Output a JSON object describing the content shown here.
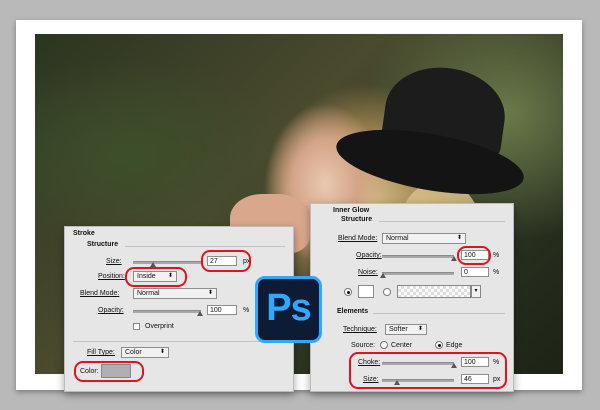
{
  "stroke": {
    "title": "Stroke",
    "structure": "Structure",
    "size_label": "Size:",
    "size_value": "27",
    "size_unit": "px",
    "size_slider": 0.33,
    "position_label": "Position:",
    "position_value": "Inside",
    "blend_label": "Blend Mode:",
    "blend_value": "Normal",
    "opacity_label": "Opacity:",
    "opacity_value": "100",
    "opacity_unit": "%",
    "opacity_slider": 1.0,
    "overprint_label": "Overprint",
    "fill_type_label": "Fill Type:",
    "fill_type_value": "Color",
    "color_label": "Color:",
    "color_swatch": "#b0b0b0"
  },
  "inner_glow": {
    "title": "Inner Glow",
    "structure": "Structure",
    "blend_label": "Blend Mode:",
    "blend_value": "Normal",
    "opacity_label": "Opacity:",
    "opacity_value": "100",
    "opacity_unit": "%",
    "opacity_slider": 1.0,
    "noise_label": "Noise:",
    "noise_value": "0",
    "noise_unit": "%",
    "noise_slider": 0.0,
    "elements": "Elements",
    "technique_label": "Technique:",
    "technique_value": "Softer",
    "source_label": "Source:",
    "source_center": "Center",
    "source_edge": "Edge",
    "choke_label": "Choke:",
    "choke_value": "100",
    "choke_unit": "%",
    "choke_slider": 1.0,
    "size_label": "Size:",
    "size_value": "46",
    "size_unit": "px",
    "size_slider": 0.18
  },
  "logo": {
    "text": "Ps"
  },
  "colors": {
    "highlight": "#e0141c",
    "ps_blue": "#31a8ff",
    "ps_bg": "#0d1c34"
  }
}
